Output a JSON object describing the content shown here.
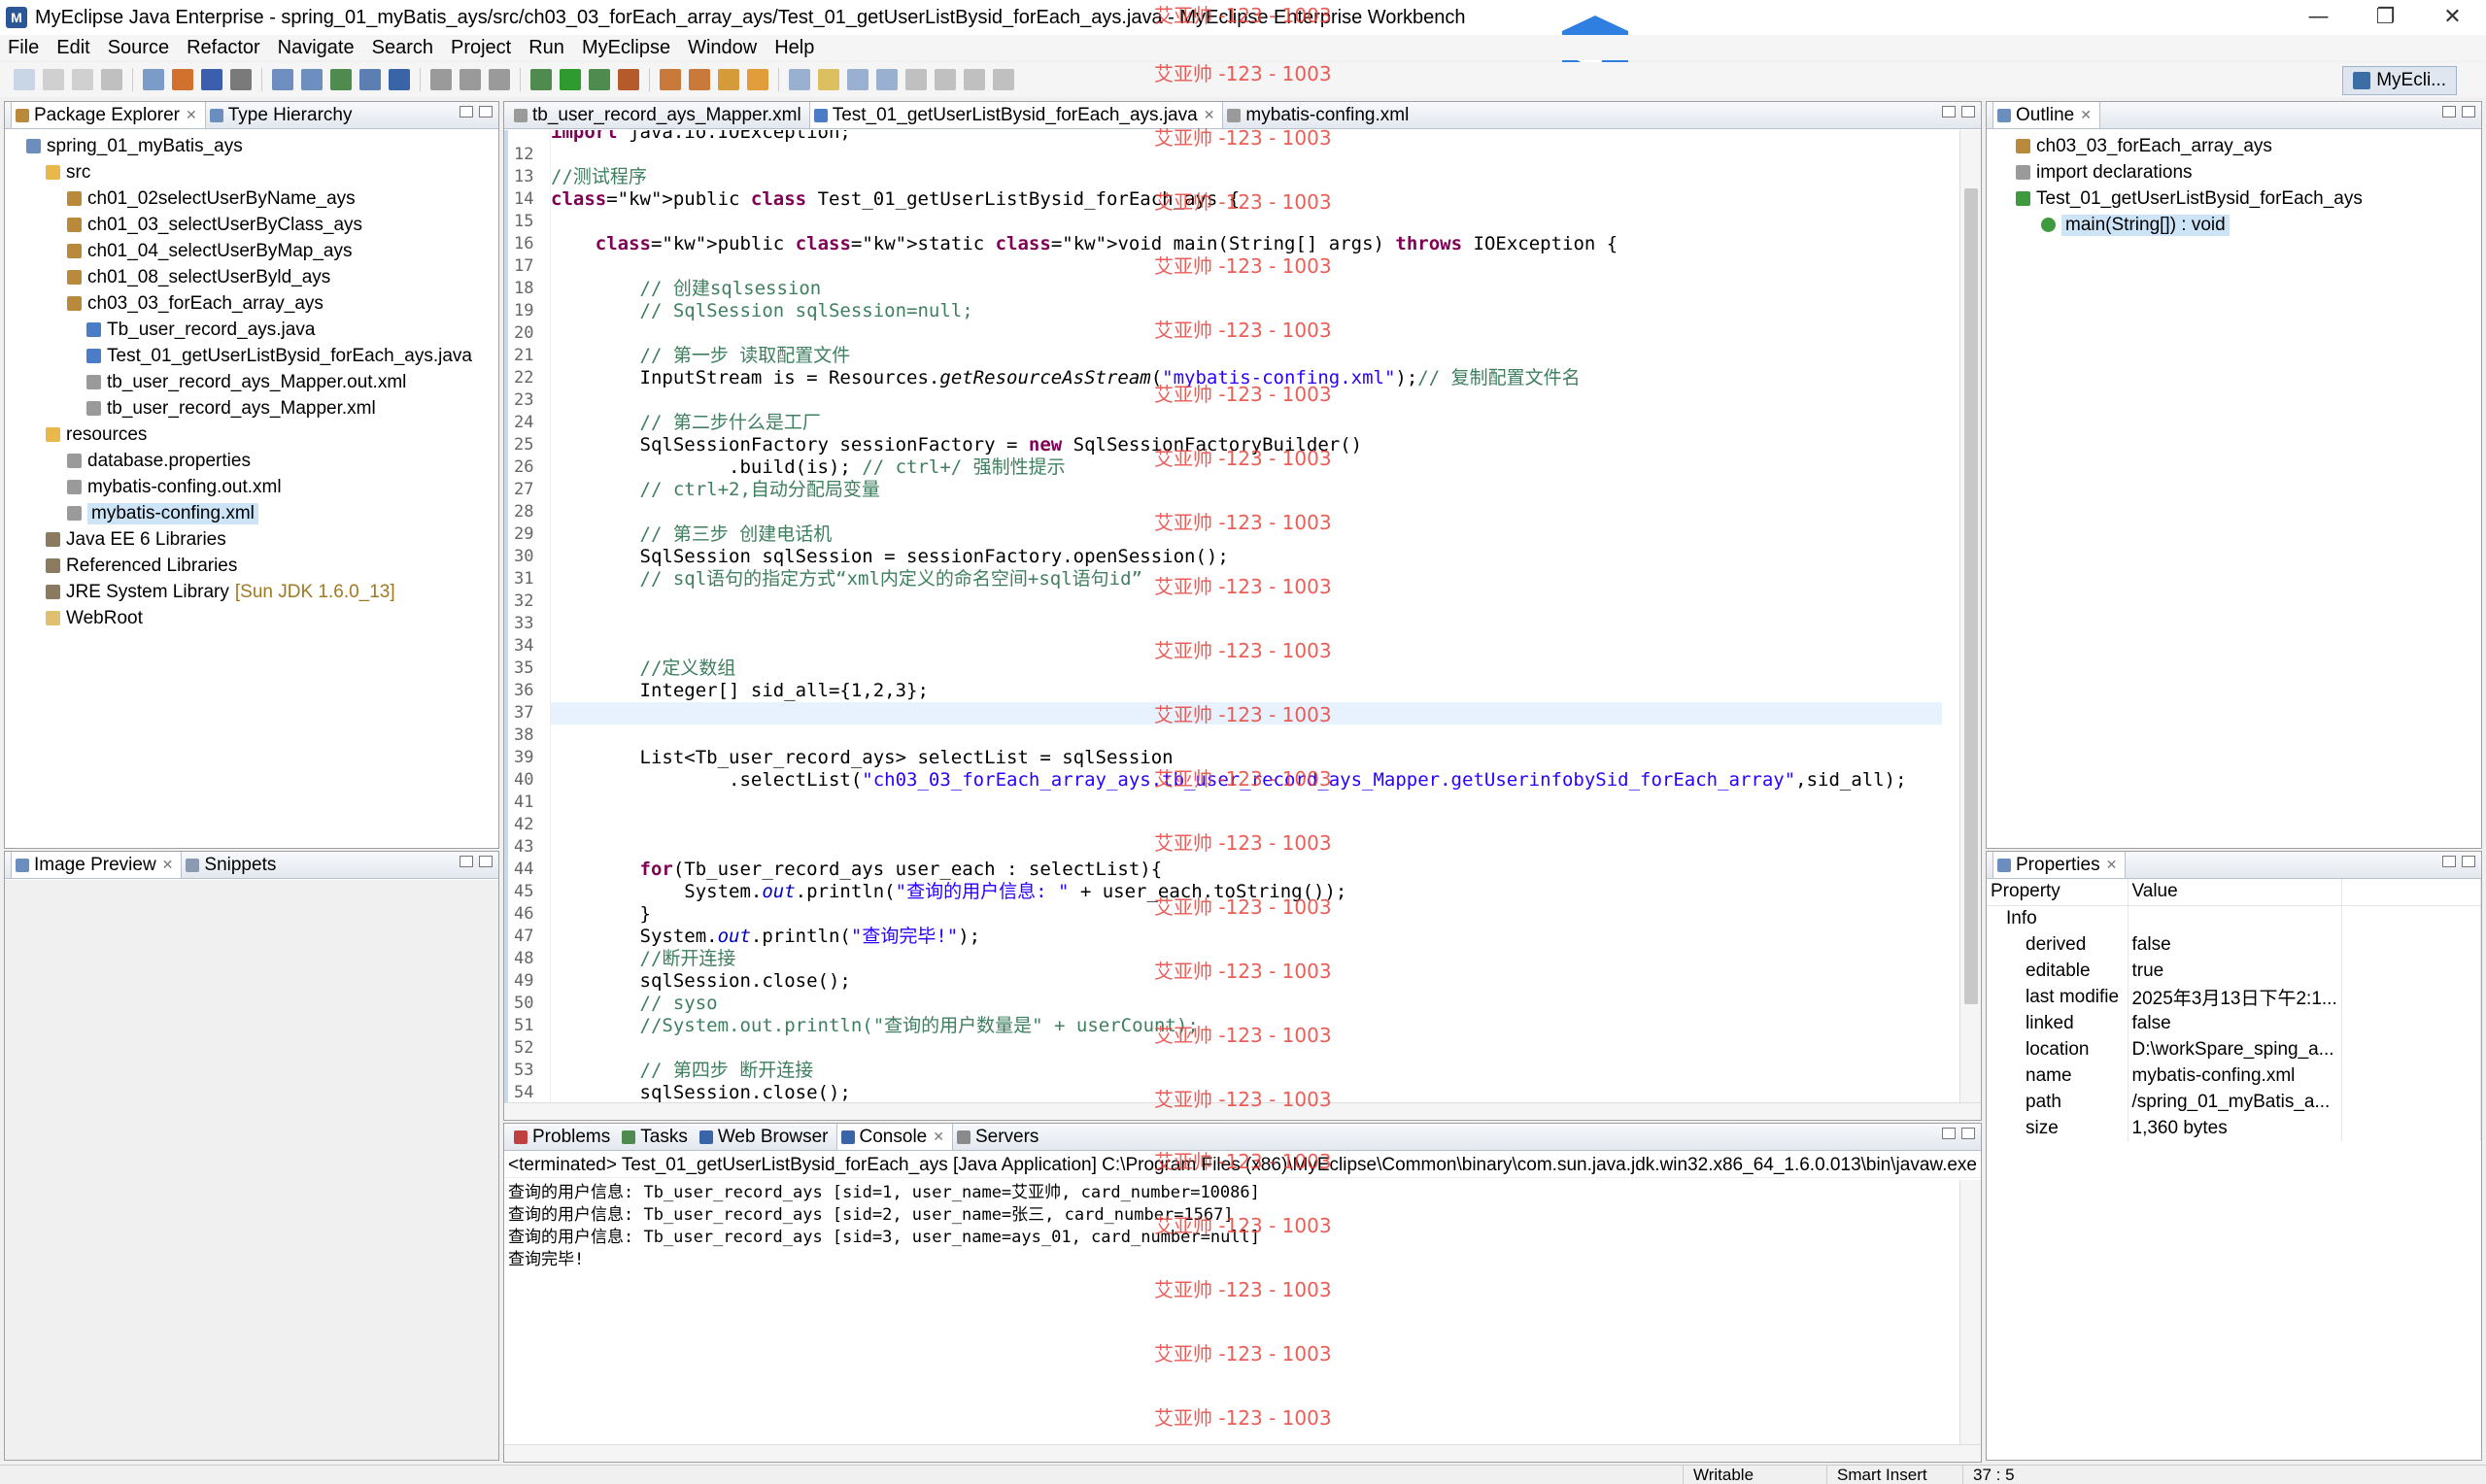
{
  "window": {
    "title": "MyEclipse Java Enterprise - spring_01_myBatis_ays/src/ch03_03_forEach_array_ays/Test_01_getUserListBysid_forEach_ays.java - MyEclipse Enterprise Workbench",
    "minimize": "—",
    "maximize": "❐",
    "close": "✕"
  },
  "menu": [
    "File",
    "Edit",
    "Source",
    "Refactor",
    "Navigate",
    "Search",
    "Project",
    "Run",
    "MyEclipse",
    "Window",
    "Help"
  ],
  "perspective": {
    "label": "MyEcli..."
  },
  "package_explorer": {
    "tabs": [
      "Package Explorer",
      "Type Hierarchy"
    ],
    "tree": [
      {
        "label": "spring_01_myBatis_ays",
        "icon": "project-icon"
      },
      {
        "label": "src",
        "icon": "source-folder-icon"
      },
      {
        "label": "ch01_02selectUserByName_ays",
        "icon": "package-icon"
      },
      {
        "label": "ch01_03_selectUserByClass_ays",
        "icon": "package-icon"
      },
      {
        "label": "ch01_04_selectUserByMap_ays",
        "icon": "package-icon"
      },
      {
        "label": "ch01_08_selectUserByld_ays",
        "icon": "package-icon"
      },
      {
        "label": "ch03_03_forEach_array_ays",
        "icon": "package-icon"
      },
      {
        "label": "Tb_user_record_ays.java",
        "icon": "java-file-icon"
      },
      {
        "label": "Test_01_getUserListBysid_forEach_ays.java",
        "icon": "java-file-icon"
      },
      {
        "label": "tb_user_record_ays_Mapper.out.xml",
        "icon": "xml-file-icon"
      },
      {
        "label": "tb_user_record_ays_Mapper.xml",
        "icon": "xml-file-icon"
      },
      {
        "label": "resources",
        "icon": "source-folder-icon"
      },
      {
        "label": "database.properties",
        "icon": "properties-file-icon"
      },
      {
        "label": "mybatis-confing.out.xml",
        "icon": "xml-file-icon"
      },
      {
        "label": "mybatis-confing.xml",
        "icon": "xml-file-icon"
      },
      {
        "label": "Java EE 6 Libraries",
        "icon": "library-icon"
      },
      {
        "label": "Referenced Libraries",
        "icon": "library-icon"
      },
      {
        "label": "JRE System Library",
        "icon": "library-icon",
        "decoration": "[Sun JDK 1.6.0_13]"
      },
      {
        "label": "WebRoot",
        "icon": "web-folder-icon"
      }
    ]
  },
  "image_preview": {
    "tabs": [
      "Image Preview",
      "Snippets"
    ]
  },
  "editor": {
    "tabs": [
      "tb_user_record_ays_Mapper.xml",
      "Test_01_getUserListBysid_forEach_ays.java",
      "mybatis-confing.xml"
    ],
    "lines": [
      {
        "n": "",
        "text": "import java.io.IOException;"
      },
      {
        "n": "12",
        "text": ""
      },
      {
        "n": "13",
        "text": "//测试程序"
      },
      {
        "n": "14",
        "text": "public class Test_01_getUserListBysid_forEach_ays {"
      },
      {
        "n": "15",
        "text": ""
      },
      {
        "n": "16",
        "text": "    public static void main(String[] args) throws IOException {"
      },
      {
        "n": "17",
        "text": ""
      },
      {
        "n": "18",
        "text": "        // 创建sqlsession"
      },
      {
        "n": "19",
        "text": "        // SqlSession sqlSession=null;"
      },
      {
        "n": "20",
        "text": ""
      },
      {
        "n": "21",
        "text": "        // 第一步 读取配置文件"
      },
      {
        "n": "22",
        "text": "        InputStream is = Resources.getResourceAsStream(\"mybatis-confing.xml\");// 复制配置文件名"
      },
      {
        "n": "23",
        "text": ""
      },
      {
        "n": "24",
        "text": "        // 第二步什么是工厂"
      },
      {
        "n": "25",
        "text": "        SqlSessionFactory sessionFactory = new SqlSessionFactoryBuilder()"
      },
      {
        "n": "26",
        "text": "                .build(is); // ctrl+/ 强制性提示"
      },
      {
        "n": "27",
        "text": "        // ctrl+2,自动分配局变量"
      },
      {
        "n": "28",
        "text": ""
      },
      {
        "n": "29",
        "text": "        // 第三步 创建电话机"
      },
      {
        "n": "30",
        "text": "        SqlSession sqlSession = sessionFactory.openSession();"
      },
      {
        "n": "31",
        "text": "        // sql语句的指定方式“xml内定义的命名空间+sql语句id”"
      },
      {
        "n": "32",
        "text": ""
      },
      {
        "n": "33",
        "text": ""
      },
      {
        "n": "34",
        "text": ""
      },
      {
        "n": "35",
        "text": "        //定义数组"
      },
      {
        "n": "36",
        "text": "        Integer[] sid_all={1,2,3};"
      },
      {
        "n": "37",
        "text": ""
      },
      {
        "n": "38",
        "text": ""
      },
      {
        "n": "39",
        "text": "        List<Tb_user_record_ays> selectList = sqlSession"
      },
      {
        "n": "40",
        "text": "                .selectList(\"ch03_03_forEach_array_ays.tb_user_record_ays_Mapper.getUserinfobySid_forEach_array\",sid_all);"
      },
      {
        "n": "41",
        "text": ""
      },
      {
        "n": "42",
        "text": ""
      },
      {
        "n": "43",
        "text": ""
      },
      {
        "n": "44",
        "text": "        for(Tb_user_record_ays user_each : selectList){"
      },
      {
        "n": "45",
        "text": "            System.out.println(\"查询的用户信息: \" + user_each.toString());"
      },
      {
        "n": "46",
        "text": "        }"
      },
      {
        "n": "47",
        "text": "        System.out.println(\"查询完毕!\");"
      },
      {
        "n": "48",
        "text": "        //断开连接"
      },
      {
        "n": "49",
        "text": "        sqlSession.close();"
      },
      {
        "n": "50",
        "text": "        // syso"
      },
      {
        "n": "51",
        "text": "        //System.out.println(\"查询的用户数量是\" + userCount);"
      },
      {
        "n": "52",
        "text": ""
      },
      {
        "n": "53",
        "text": "        // 第四步 断开连接"
      },
      {
        "n": "54",
        "text": "        sqlSession.close();"
      }
    ]
  },
  "watermark": "艾亚帅 -123 - 1003",
  "outline": {
    "tab": "Outline",
    "items": [
      {
        "label": "ch03_03_forEach_array_ays",
        "icon": "package-icon"
      },
      {
        "label": "import declarations",
        "icon": "imports-icon"
      },
      {
        "label": "Test_01_getUserListBysid_forEach_ays",
        "icon": "class-icon"
      },
      {
        "label": "main(String[]) : void",
        "icon": "method-icon"
      }
    ]
  },
  "properties": {
    "tab": "Properties",
    "header": [
      "Property",
      "Value"
    ],
    "group": "Info",
    "rows": [
      {
        "key": "derived",
        "value": "false"
      },
      {
        "key": "editable",
        "value": "true"
      },
      {
        "key": "last modifie",
        "value": "2025年3月13日下午2:1..."
      },
      {
        "key": "linked",
        "value": "false"
      },
      {
        "key": "location",
        "value": "D:\\workSpare_sping_a..."
      },
      {
        "key": "name",
        "value": "mybatis-confing.xml"
      },
      {
        "key": "path",
        "value": "/spring_01_myBatis_a..."
      },
      {
        "key": "size",
        "value": "1,360  bytes"
      }
    ]
  },
  "console": {
    "tabs": [
      "Problems",
      "Tasks",
      "Web Browser",
      "Console",
      "Servers"
    ],
    "terminated": "<terminated> Test_01_getUserListBysid_forEach_ays [Java Application] C:\\Program Files (x86)\\MyEclipse\\Common\\binary\\com.sun.java.jdk.win32.x86_64_1.6.0.013\\bin\\javaw.exe",
    "lines": [
      "查询的用户信息: Tb_user_record_ays [sid=1, user_name=艾亚帅, card_number=10086]",
      "查询的用户信息: Tb_user_record_ays [sid=2, user_name=张三, card_number=1567]",
      "查询的用户信息: Tb_user_record_ays [sid=3, user_name=ays_01, card_number=null]",
      "查询完毕!"
    ]
  },
  "status": {
    "writable": "Writable",
    "insert_mode": "Smart Insert",
    "position": "37 : 5"
  }
}
